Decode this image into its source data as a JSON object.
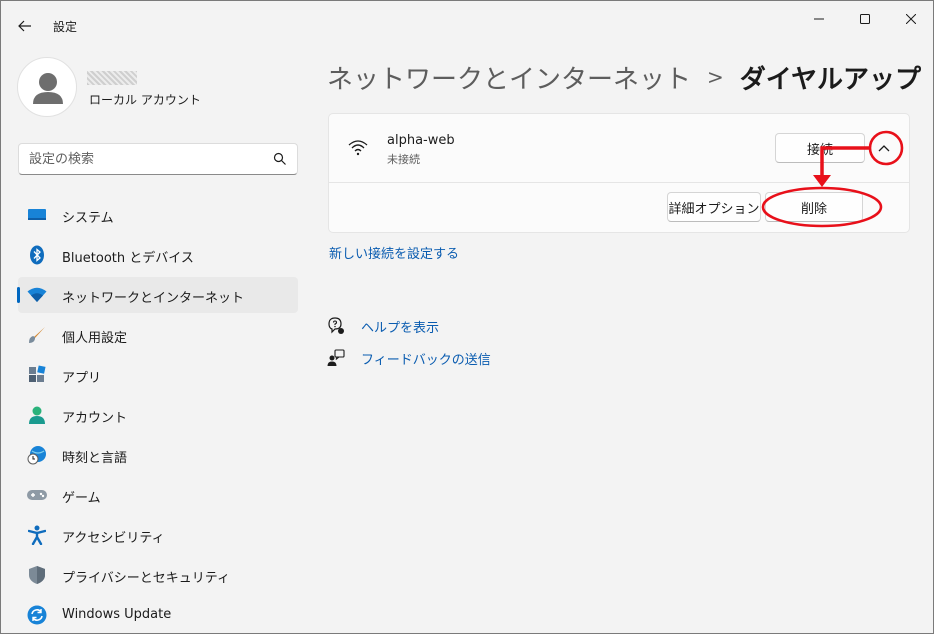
{
  "window": {
    "title": "設定",
    "controls": {
      "minimize": "minimize-icon",
      "maximize": "maximize-icon",
      "close": "close-icon"
    }
  },
  "profile": {
    "account_type": "ローカル アカウント"
  },
  "search": {
    "placeholder": "設定の検索"
  },
  "sidebar": {
    "items": [
      {
        "label": "システム",
        "icon": "system-icon",
        "active": false
      },
      {
        "label": "Bluetooth とデバイス",
        "icon": "bluetooth-icon",
        "active": false
      },
      {
        "label": "ネットワークとインターネット",
        "icon": "network-icon",
        "active": true
      },
      {
        "label": "個人用設定",
        "icon": "brush-icon",
        "active": false
      },
      {
        "label": "アプリ",
        "icon": "apps-icon",
        "active": false
      },
      {
        "label": "アカウント",
        "icon": "account-icon",
        "active": false
      },
      {
        "label": "時刻と言語",
        "icon": "time-language-icon",
        "active": false
      },
      {
        "label": "ゲーム",
        "icon": "gamepad-icon",
        "active": false
      },
      {
        "label": "アクセシビリティ",
        "icon": "accessibility-icon",
        "active": false
      },
      {
        "label": "プライバシーとセキュリティ",
        "icon": "shield-icon",
        "active": false
      },
      {
        "label": "Windows Update",
        "icon": "update-icon",
        "active": false
      }
    ]
  },
  "breadcrumb": {
    "parent": "ネットワークとインターネット",
    "separator": ">",
    "current": "ダイヤルアップ"
  },
  "connection": {
    "name": "alpha-web",
    "status": "未接続",
    "connect_label": "接続",
    "advanced_label": "詳細オプション",
    "delete_label": "削除"
  },
  "new_connection_link": "新しい接続を設定する",
  "help": {
    "get_help": "ヘルプを表示",
    "feedback": "フィードバックの送信"
  },
  "colors": {
    "accent": "#0067c0",
    "annotation": "#e8101a",
    "link": "#0a5cb0"
  }
}
